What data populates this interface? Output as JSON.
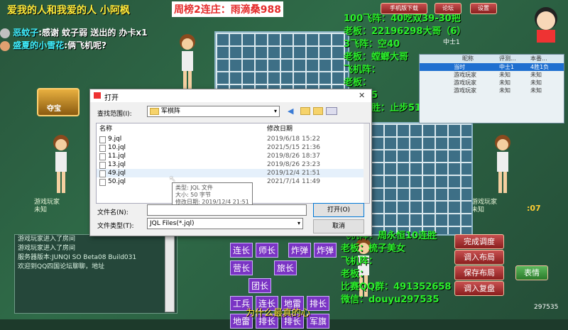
{
  "stream_title": "爱我的人和我爱的人 小阿枫",
  "weekly": "周榜2连庄：雨滴桑988",
  "chat_overlay": [
    {
      "name": "恶蚊子",
      "text": ":感谢 蚊子弱 送出的 办卡x1"
    },
    {
      "name": "盛夏的小雪花",
      "text": ":俩飞机呢?"
    }
  ],
  "top_right_overlay": [
    "100飞阵：40吃双39-30把",
    "老板：22196298大哥（6）",
    "3飞阵：空40",
    "老板：螳螂大哥",
    "飞机阵：",
    "老板：",
    "连胜：5",
    "随机连胜：止步51连胜"
  ],
  "bottom_right_overlay": [
    "飞机阵：周永恒10连胜",
    "老板：梳子美女",
    "飞机阵：",
    "老板：",
    "比赛QQ群：491352658",
    "微信：douyu297535"
  ],
  "subtitle": "为什么最真的心",
  "dialog": {
    "title": "打开",
    "lookin_label": "查找范围(I):",
    "folder": "军棋阵",
    "col_name": "名称",
    "col_date": "修改日期",
    "files": [
      {
        "name": "9.jql",
        "date": "2019/6/18 15:22"
      },
      {
        "name": "10.jql",
        "date": "2021/5/15 21:36"
      },
      {
        "name": "11.jql",
        "date": "2019/8/26 18:37"
      },
      {
        "name": "13.jql",
        "date": "2019/8/26 23:23"
      },
      {
        "name": "49.jql",
        "date": "2019/12/4 21:51"
      },
      {
        "name": "50.jql",
        "date": "2021/7/14 11:49"
      }
    ],
    "tooltip": [
      "类型: JQL 文件",
      "大小: 50 字节",
      "修改日期: 2019/12/4 21:51"
    ],
    "filename_label": "文件名(N):",
    "filetype_label": "文件类型(T):",
    "filetype": "JQL Files(*.jql)",
    "open": "打开(O)",
    "cancel": "取消"
  },
  "players": {
    "left": {
      "name": "游戏玩家",
      "status": "未知"
    },
    "right": {
      "name": "游戏玩家",
      "status": "未知"
    }
  },
  "chat_log": [
    "游戏玩家进入了房间",
    "游戏玩家进入了房间",
    "服务器版本:JUNQI SO Beta08 Build031",
    "欢迎到QQ四国论坛聊聊，地址"
  ],
  "pieces": [
    [
      "连长",
      "师长",
      "炸弹",
      "炸弹"
    ],
    [
      "营长",
      "旅长",
      "团长"
    ],
    [
      "工兵",
      "连长",
      "地雷",
      "排长",
      "地雷"
    ],
    [
      "地雷",
      "排长",
      "排长",
      "军旗",
      "排长"
    ]
  ],
  "buttons": [
    "完成调度",
    "调入布局",
    "保存布局",
    "调入复盘"
  ],
  "emote": "表情",
  "room": {
    "cols": [
      "昵称",
      "评测...",
      "本番..."
    ],
    "rows": [
      [
        "当时",
        "中士1",
        "4胜1负"
      ],
      [
        "游戏玩家",
        "未知",
        "未知"
      ],
      [
        "游戏玩家",
        "未知",
        "未知"
      ],
      [
        "游戏玩家",
        "未知",
        "未知"
      ]
    ]
  },
  "top_buttons": [
    "手机版下载",
    "论坛",
    "设置"
  ],
  "rank_label": "中士1",
  "treasure_label": "夺宝",
  "side_counter": "297535",
  "timer": ":07",
  "user_id": "297535"
}
